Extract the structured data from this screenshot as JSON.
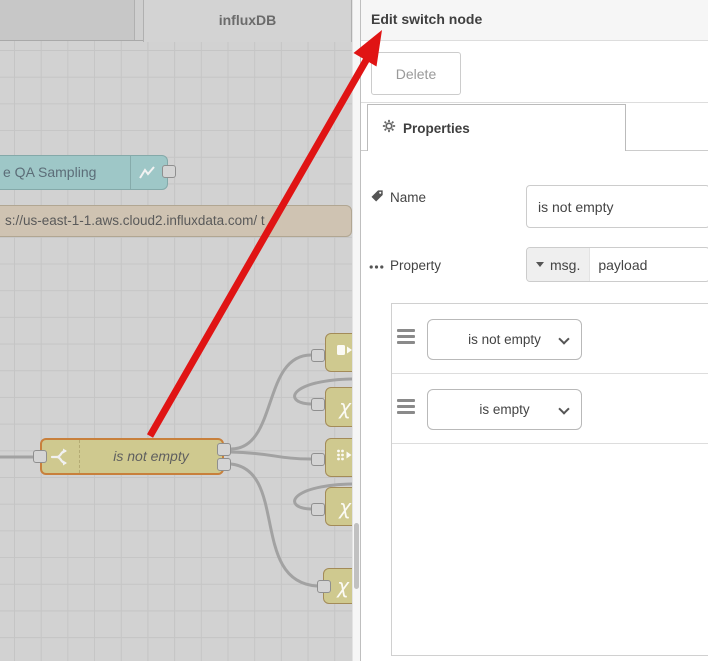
{
  "colors": {
    "canvas_bg": "#d2d2d2",
    "grid_line": "#c5c5c5",
    "node_teal": "#9ec7c7",
    "node_tan": "#cfc3b2",
    "node_khaki": "#cfc98f",
    "selected_border": "#c8803c",
    "wire": "#a2a2a2",
    "annotation_arrow": "#e01414"
  },
  "workspace": {
    "tabs": [
      {
        "label": ""
      },
      {
        "label": "influxDB"
      }
    ],
    "nodes": {
      "qa": {
        "label": "e QA Sampling",
        "icon": "chart-line-icon"
      },
      "influx": {
        "label": "s://us-east-1-1.aws.cloud2.influxdata.com/ t"
      },
      "switch": {
        "label": "is not empty",
        "icon": "switch-icon"
      },
      "side_nodes": [
        {
          "icon": "template-icon"
        },
        {
          "icon": "chi-icon",
          "glyph": "χ"
        },
        {
          "icon": "split-icon"
        },
        {
          "icon": "chi-icon",
          "glyph": "χ"
        },
        {
          "icon": "chi-icon",
          "glyph": "χ"
        }
      ]
    }
  },
  "tray": {
    "title": "Edit switch node",
    "delete_label": "Delete",
    "properties_tab": "Properties",
    "form": {
      "name_label": "Name",
      "name_value": "is not empty",
      "property_label": "Property",
      "property_type": "msg.",
      "property_value": "payload",
      "rules": [
        {
          "operator": "is not empty"
        },
        {
          "operator": "is empty"
        }
      ]
    }
  }
}
